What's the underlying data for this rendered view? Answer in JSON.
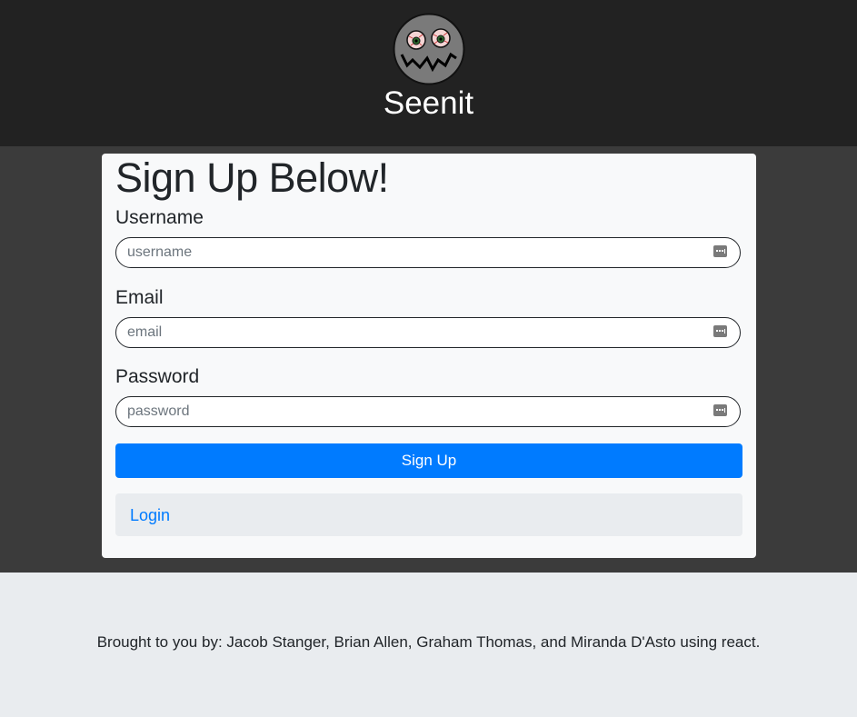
{
  "header": {
    "brand": "Seenit",
    "logo_icon": "monster-face-icon"
  },
  "form": {
    "title": "Sign Up Below!",
    "username": {
      "label": "Username",
      "placeholder": "username"
    },
    "email": {
      "label": "Email",
      "placeholder": "email"
    },
    "password": {
      "label": "Password",
      "placeholder": "password"
    },
    "field_icon": "password-manager-key-icon",
    "submit_label": "Sign Up",
    "login_label": "Login"
  },
  "footer": {
    "text": "Brought to you by: Jacob Stanger, Brian Allen, Graham Thomas, and Miranda D'Asto using react."
  },
  "colors": {
    "header_bg": "#222222",
    "main_bg": "#3b3b3b",
    "card_bg": "#f8f9fa",
    "primary": "#007bff",
    "footer_bg": "#e9ecef"
  }
}
